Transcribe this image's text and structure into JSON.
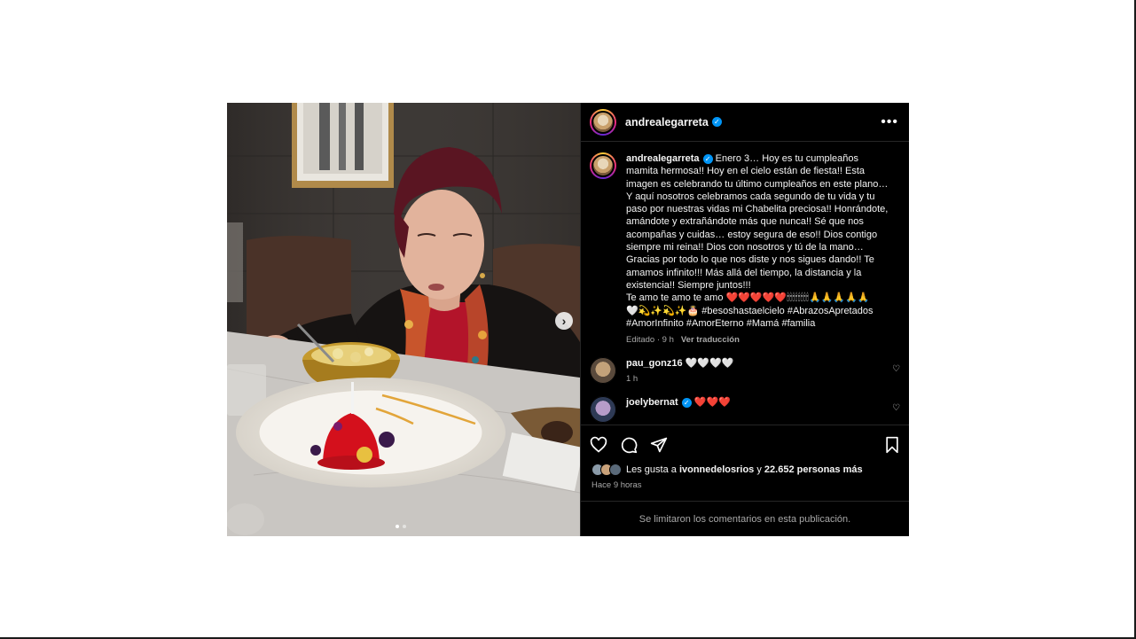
{
  "post": {
    "author": "andrealegarreta",
    "more_icon": "more-horizontal-icon",
    "caption": {
      "username": "andrealegarreta",
      "text": "Enero 3… Hoy es tu cumpleaños mamita hermosa!! Hoy en el cielo están de fiesta!! Esta imagen es celebrando tu último cumpleaños en este plano… Y aquí nosotros celebramos cada segundo de tu vida y tu paso por nuestras vidas mi Chabelita preciosa!! Honrándote, amándote y extrañándote más que nunca!! Sé que nos acompañas y cuidas… estoy segura de eso!! Dios contigo siempre mi reina!! Dios con nosotros y tú de la mano… Gracias por todo lo que nos diste y nos sigues dando!! Te amamos infinito!!! Más allá del tiempo, la distancia y la existencia!! Siempre juntos!!!",
      "text2": "Te amo te amo te amo ❤️❤️❤️❤️❤️🕯🕯🕯🕯🕯🕯🕯🕯🙏🙏🙏🙏🙏",
      "text3": "🤍💫✨💫✨🎂 #besoshastaelcielo #AbrazosApretados #AmorInfinito #AmorEterno #Mamá #familia",
      "edited": "Editado · 9 h",
      "translate": "Ver traducción"
    },
    "comments": [
      {
        "username": "pau_gonz16",
        "text": "🤍🤍🤍🤍",
        "time": "1 h"
      },
      {
        "username": "joelybernat",
        "text": "❤️❤️❤️",
        "time": ""
      }
    ],
    "likes": {
      "prefix": "Les gusta a ",
      "user": "ivonnedelosrios",
      "middle": " y ",
      "count": "22.652 personas más"
    },
    "ago": "Hace 9 horas",
    "limited_notice": "Se limitaron los comentarios en esta publicación.",
    "carousel": {
      "current": 1,
      "total": 2
    }
  },
  "colors": {
    "verified": "#0095f6",
    "panel_bg": "#000000",
    "secondary_text": "#a8a8a8"
  }
}
